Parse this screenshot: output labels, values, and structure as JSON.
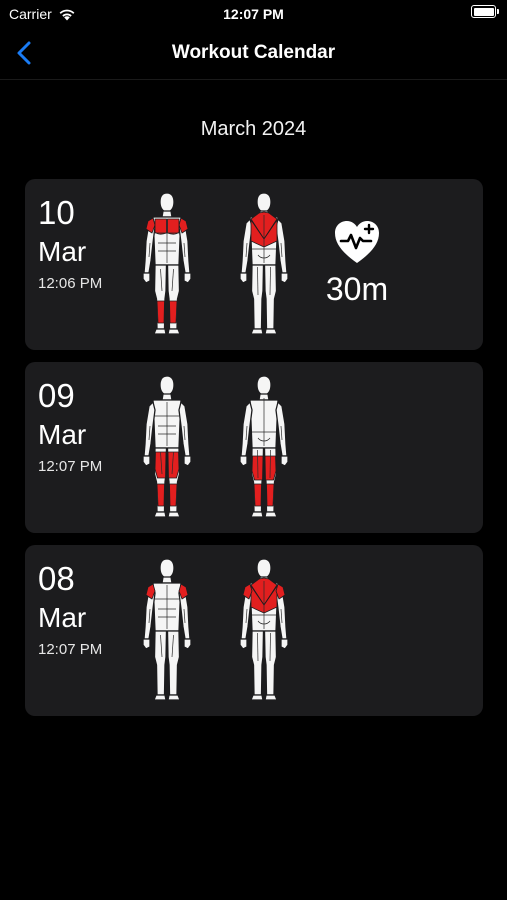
{
  "status_bar": {
    "carrier": "Carrier",
    "time": "12:07 PM",
    "wifi_icon": "wifi-icon",
    "battery_icon": "battery-full-icon"
  },
  "nav": {
    "title": "Workout Calendar",
    "back_icon": "chevron-left-icon",
    "accent_color": "#1a7cf5"
  },
  "month_label": "March 2024",
  "highlight_color": "#e21f1f",
  "workouts": [
    {
      "day": "10",
      "month": "Mar",
      "time": "12:06 PM",
      "front_muscles": [
        "shoulders",
        "chest",
        "calves"
      ],
      "back_muscles": [
        "traps",
        "upper-back"
      ],
      "activity_icon": "heart-pulse-icon",
      "duration": "30m"
    },
    {
      "day": "09",
      "month": "Mar",
      "time": "12:07 PM",
      "front_muscles": [
        "quads",
        "calves"
      ],
      "back_muscles": [
        "hamstrings",
        "calves"
      ]
    },
    {
      "day": "08",
      "month": "Mar",
      "time": "12:07 PM",
      "front_muscles": [
        "shoulders"
      ],
      "back_muscles": [
        "traps",
        "upper-back",
        "rear-delts"
      ]
    }
  ]
}
